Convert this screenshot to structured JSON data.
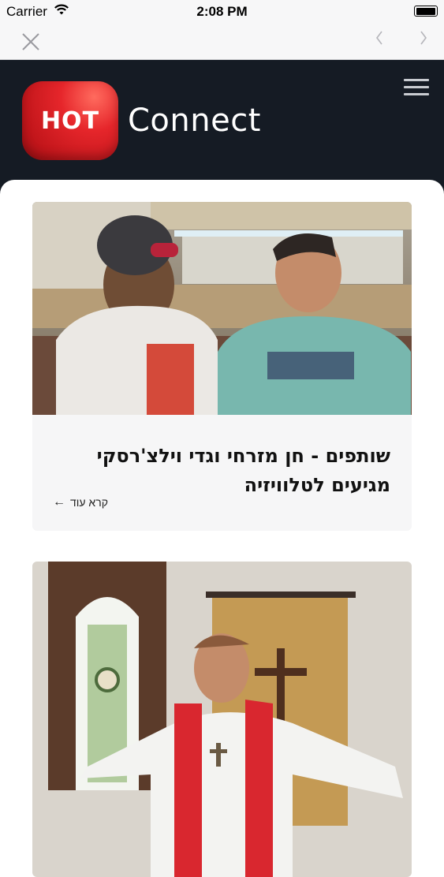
{
  "status_bar": {
    "carrier": "Carrier",
    "time": "2:08 PM"
  },
  "browser": {
    "back_icon": "chevron-left-icon",
    "forward_icon": "chevron-right-icon",
    "close_icon": "close-icon"
  },
  "header": {
    "logo_text": "HOT",
    "brand_name": "Connect",
    "menu_icon": "hamburger-icon",
    "background": "#151b24",
    "logo_color": "#e6262b"
  },
  "articles": [
    {
      "title": "שותפים - חן מזרחי וגדי וילצ'רסקי מגיעים לטלוויזיה",
      "read_more": "קרא עוד",
      "arrow": "←"
    },
    {
      "title": "",
      "read_more": ""
    }
  ]
}
